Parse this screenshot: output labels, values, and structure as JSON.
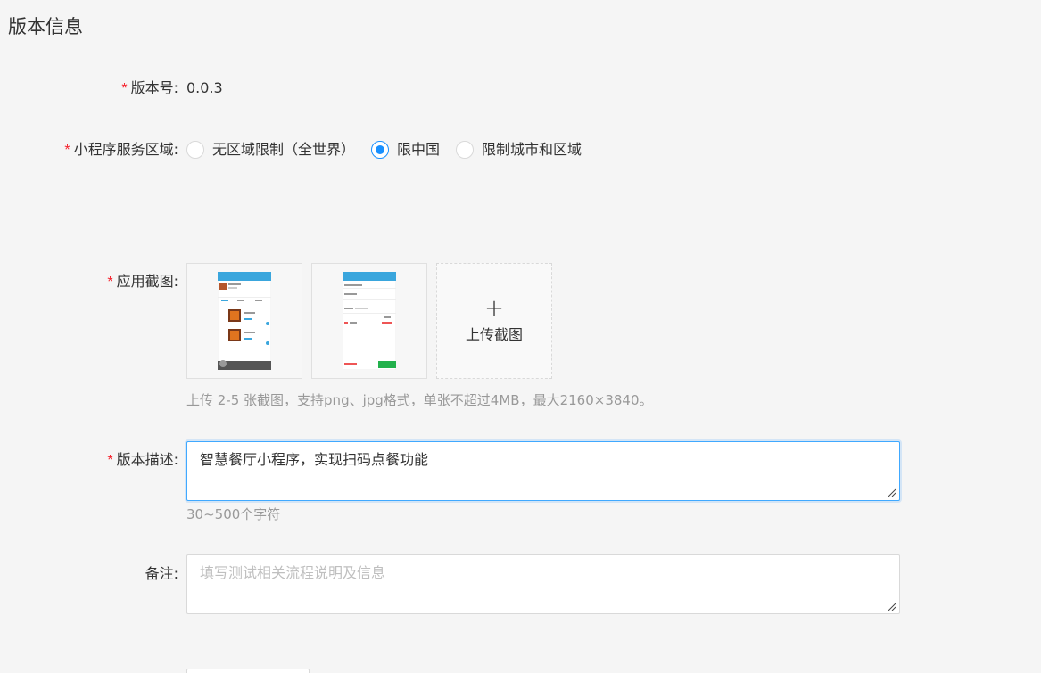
{
  "section": {
    "title": "版本信息"
  },
  "version": {
    "label": "版本号:",
    "value": "0.0.3"
  },
  "region": {
    "label": "小程序服务区域:",
    "options": [
      {
        "label": "无区域限制（全世界）",
        "checked": false
      },
      {
        "label": "限中国",
        "checked": true
      },
      {
        "label": "限制城市和区域",
        "checked": false
      }
    ]
  },
  "screenshots": {
    "label": "应用截图:",
    "upload_label": "上传截图",
    "upload_icon": "plus-icon",
    "hint": "上传 2-5 张截图，支持png、jpg格式，单张不超过4MB，最大2160×3840。"
  },
  "description": {
    "label": "版本描述:",
    "value": "智慧餐厅小程序，实现扫码点餐功能",
    "hint": "30~500个字符"
  },
  "remark": {
    "label": "备注:",
    "placeholder": "填写测试相关流程说明及信息"
  },
  "colors": {
    "required": "#f5222d",
    "accent": "#1890ff"
  }
}
